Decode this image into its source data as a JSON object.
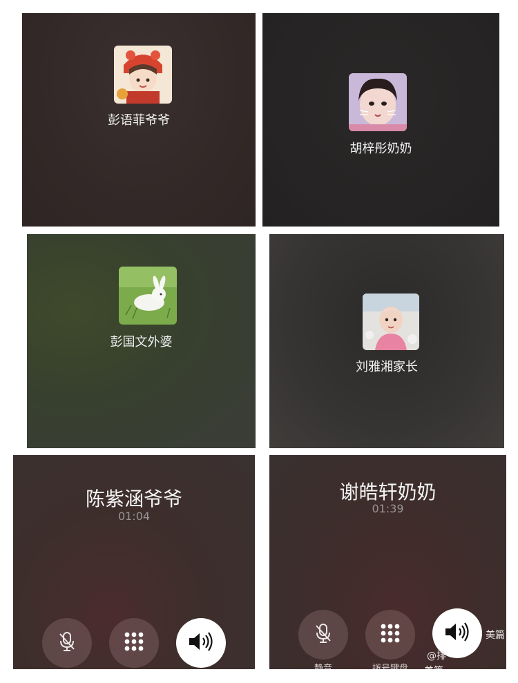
{
  "panels": [
    {
      "contact_name": "彭语菲爷爷"
    },
    {
      "contact_name": "胡梓彤奶奶"
    },
    {
      "contact_name": "彭国文外婆"
    },
    {
      "contact_name": "刘雅湘家长"
    },
    {
      "contact_name": "陈紫涵爷爷",
      "call_duration": "01:04"
    },
    {
      "contact_name": "谢皓轩奶奶",
      "call_duration": "01:39"
    }
  ],
  "controls": {
    "mute_label": "静音",
    "keypad_label": "拨号键盘"
  },
  "watermark": {
    "brand": "美篇",
    "line1": "@排",
    "line2": "美篇"
  },
  "colors": {
    "speaker_button": "#ffffff",
    "dark_button": "#7a5f5f"
  }
}
